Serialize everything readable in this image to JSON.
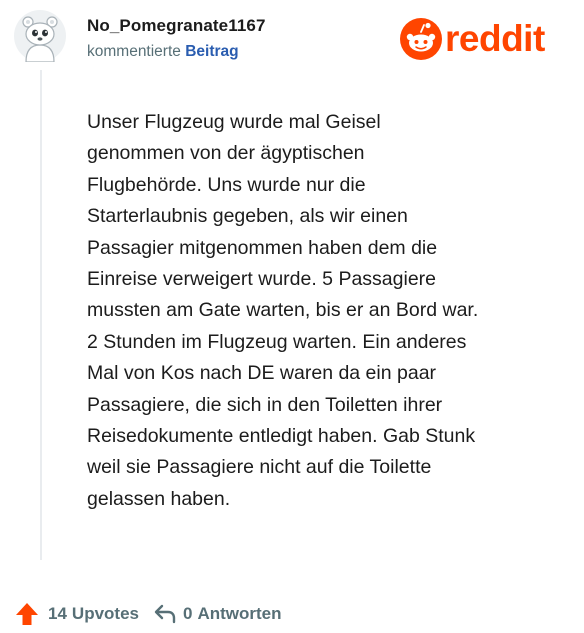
{
  "comment": {
    "author": "No_Pomegranate1167",
    "action": "kommentierte",
    "target_link": "Beitrag",
    "body": "Unser Flugzeug wurde mal Geisel\ngenommen von der ägyptischen\nFlugbehörde. Uns wurde nur die\nStarterlaubnis gegeben, als wir einen\nPassagier mitgenommen haben dem die\nEinreise verweigert wurde. 5 Passagiere\nmussten am Gate warten, bis er an Bord war.\n2 Stunden im Flugzeug warten. Ein anderes\nMal von Kos nach DE waren da ein paar\nPassagiere, die sich in den Toiletten ihrer\nReisedokumente entledigt haben. Gab Stunk\nweil sie Passagiere nicht auf die Toilette\ngelassen haben."
  },
  "brand": {
    "wordmark": "reddit",
    "icon": "reddit-snoo-icon",
    "color": "#ff4500"
  },
  "footer": {
    "upvotes_count": "14",
    "upvotes_label": "Upvotes",
    "replies_count": "0",
    "replies_label": "Antworten",
    "upvote_icon": "upvote-arrow-icon",
    "reply_icon": "reply-arrow-icon",
    "upvote_color": "#ff4500"
  },
  "colors": {
    "text": "#1c1c1c",
    "meta": "#576f76",
    "link": "#2a5db0",
    "thread_line": "#e9ecef"
  }
}
